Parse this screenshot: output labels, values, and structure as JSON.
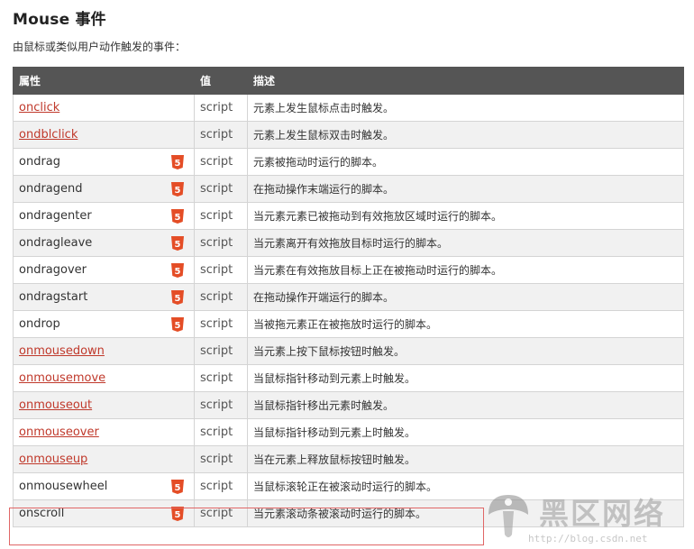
{
  "page": {
    "title": "Mouse 事件",
    "intro": "由鼠标或类似用户动作触发的事件："
  },
  "table": {
    "headers": [
      "属性",
      "值",
      "描述"
    ],
    "rows": [
      {
        "attr": "onclick",
        "link": true,
        "html5": false,
        "value": "script",
        "desc": "元素上发生鼠标点击时触发。"
      },
      {
        "attr": "ondblclick",
        "link": true,
        "html5": false,
        "value": "script",
        "desc": "元素上发生鼠标双击时触发。"
      },
      {
        "attr": "ondrag",
        "link": false,
        "html5": true,
        "value": "script",
        "desc": "元素被拖动时运行的脚本。"
      },
      {
        "attr": "ondragend",
        "link": false,
        "html5": true,
        "value": "script",
        "desc": "在拖动操作末端运行的脚本。"
      },
      {
        "attr": "ondragenter",
        "link": false,
        "html5": true,
        "value": "script",
        "desc": "当元素元素已被拖动到有效拖放区域时运行的脚本。"
      },
      {
        "attr": "ondragleave",
        "link": false,
        "html5": true,
        "value": "script",
        "desc": "当元素离开有效拖放目标时运行的脚本。"
      },
      {
        "attr": "ondragover",
        "link": false,
        "html5": true,
        "value": "script",
        "desc": "当元素在有效拖放目标上正在被拖动时运行的脚本。"
      },
      {
        "attr": "ondragstart",
        "link": false,
        "html5": true,
        "value": "script",
        "desc": "在拖动操作开端运行的脚本。"
      },
      {
        "attr": "ondrop",
        "link": false,
        "html5": true,
        "value": "script",
        "desc": "当被拖元素正在被拖放时运行的脚本。"
      },
      {
        "attr": "onmousedown",
        "link": true,
        "html5": false,
        "value": "script",
        "desc": "当元素上按下鼠标按钮时触发。"
      },
      {
        "attr": "onmousemove",
        "link": true,
        "html5": false,
        "value": "script",
        "desc": "当鼠标指针移动到元素上时触发。"
      },
      {
        "attr": "onmouseout",
        "link": true,
        "html5": false,
        "value": "script",
        "desc": "当鼠标指针移出元素时触发。"
      },
      {
        "attr": "onmouseover",
        "link": true,
        "html5": false,
        "value": "script",
        "desc": "当鼠标指针移动到元素上时触发。"
      },
      {
        "attr": "onmouseup",
        "link": true,
        "html5": false,
        "value": "script",
        "desc": "当在元素上释放鼠标按钮时触发。"
      },
      {
        "attr": "onmousewheel",
        "link": false,
        "html5": true,
        "value": "script",
        "desc": "当鼠标滚轮正在被滚动时运行的脚本。"
      },
      {
        "attr": "onscroll",
        "link": false,
        "html5": true,
        "value": "script",
        "desc": "当元素滚动条被滚动时运行的脚本。"
      }
    ]
  },
  "watermark": {
    "text": "黑区网络",
    "url": "http://blog.csdn.net"
  },
  "colors": {
    "header_bg": "#555555",
    "link": "#c0392b",
    "html5_badge": "#e44d26",
    "row_alt": "#f1f1f1",
    "highlight_border": "#e06666"
  },
  "icons": {
    "html5_badge": "html5-icon",
    "watermark_logo": "mushroom-logo-icon"
  }
}
